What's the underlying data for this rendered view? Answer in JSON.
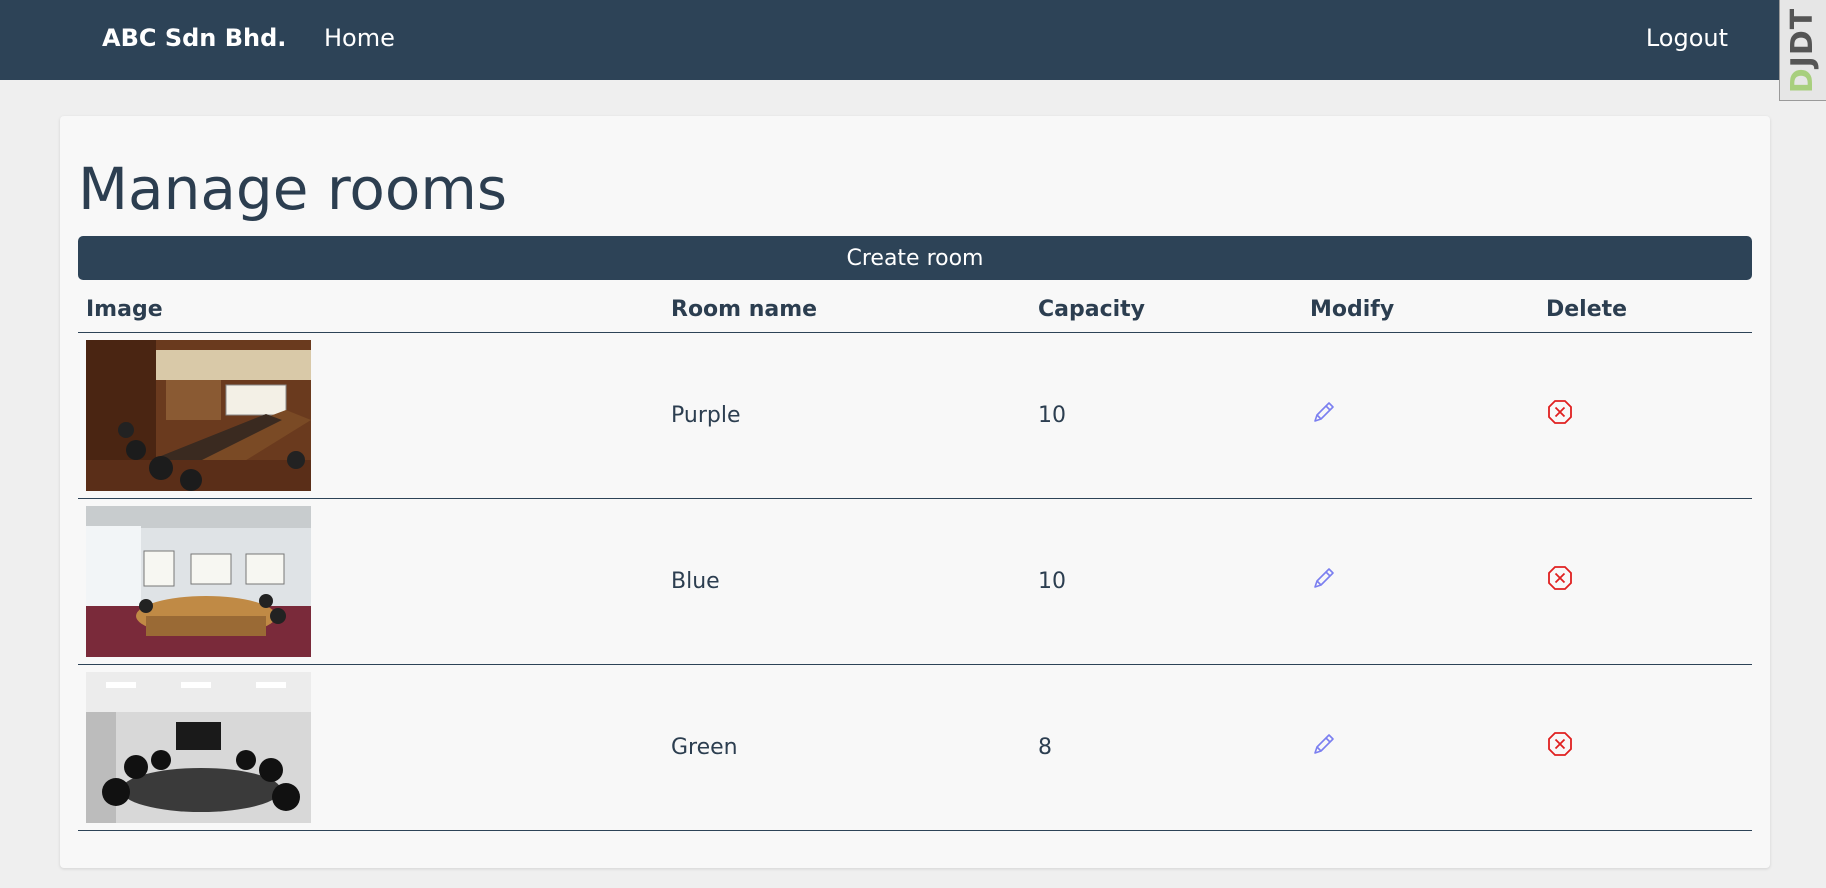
{
  "navbar": {
    "brand": "ABC Sdn Bhd.",
    "home_label": "Home",
    "logout_label": "Logout",
    "debug_toolbar_label": "DJDT"
  },
  "main": {
    "title": "Manage rooms",
    "create_label": "Create room",
    "columns": [
      "Image",
      "Room name",
      "Capacity",
      "Modify",
      "Delete"
    ],
    "rooms": [
      {
        "name": "Purple",
        "capacity": "10"
      },
      {
        "name": "Blue",
        "capacity": "10"
      },
      {
        "name": "Green",
        "capacity": "8"
      }
    ]
  },
  "icons": {
    "modify": "pencil-icon",
    "delete": "delete-circle-x-icon"
  },
  "colors": {
    "navbar": "#2d4357",
    "text": "#2c3e50",
    "modify_icon": "#7b7ff0",
    "delete_icon": "#e02020",
    "card": "#f8f8f8",
    "background": "#efefef"
  }
}
